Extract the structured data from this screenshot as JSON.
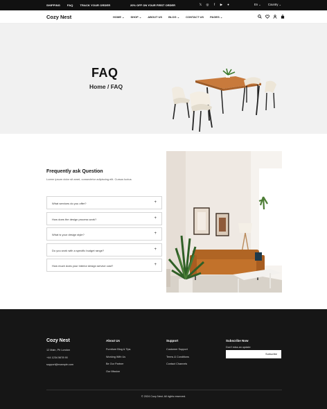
{
  "topbar": {
    "links": [
      "SHIPPING",
      "FAQ",
      "TRACK YOUR ORDER"
    ],
    "promo": "20% OFF ON YOUR FIRST ORDER",
    "language": "En",
    "country": "Country"
  },
  "header": {
    "logo": "Cozy Nest",
    "nav": [
      "HOME",
      "SHOP",
      "ABOUT US",
      "BLOG",
      "CONTACT US",
      "PAGES"
    ]
  },
  "hero": {
    "title": "FAQ",
    "breadcrumb": "Home / FAQ"
  },
  "faq": {
    "title": "Frequently ask Question",
    "subtitle": "Lorem ipsum dolor sit amet, consectetur adipiscing elit. Cursus luctus",
    "items": [
      "What services do you offer?",
      "How does the design process work?",
      "What is your design style?",
      "Do you work with a specific budget range?",
      "How much does your interior design service cost?"
    ]
  },
  "footer": {
    "logo": "Cozy Nest",
    "address": "12 Main, Ph London",
    "phone": "+44 1234 5678 90",
    "email": "support@example.com",
    "about_title": "About Us",
    "about_items": [
      "Furniture Blog & Tips",
      "Working With Us",
      "Be Our Partner",
      "Our Mission"
    ],
    "support_title": "Support",
    "support_items": [
      "Customer Support",
      "Terms & Conditions",
      "Contact Channels"
    ],
    "subscribe_title": "Subscribe Now",
    "subscribe_text": "Don't miss an update",
    "subscribe_button": "Subscribe",
    "copyright": "© 2024 Cozy Nest. All rights reserved."
  }
}
